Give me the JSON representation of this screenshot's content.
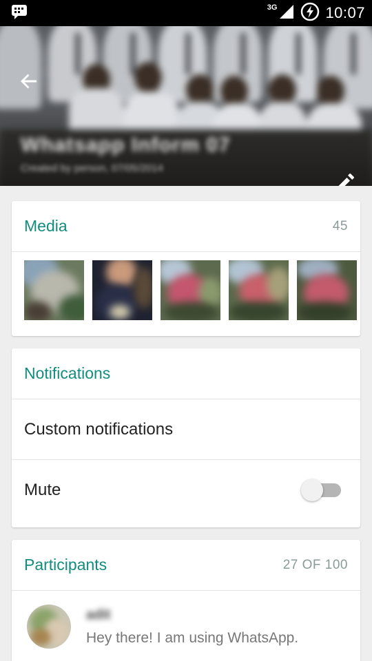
{
  "status_bar": {
    "network_type": "3G",
    "time": "10:07",
    "icons": [
      "bbm-chat-icon",
      "signal-icon",
      "battery-charging-icon"
    ]
  },
  "header": {
    "group_name": "Whatsapp Inform 07",
    "created_by": "Created by person, 07/05/2014",
    "back_icon": "arrow-back-icon",
    "edit_icon": "pencil-icon"
  },
  "media": {
    "title": "Media",
    "count": "45",
    "thumbnails": [
      "media-thumb-1",
      "media-thumb-2",
      "media-thumb-3",
      "media-thumb-4",
      "media-thumb-5"
    ]
  },
  "notifications": {
    "title": "Notifications",
    "custom_label": "Custom notifications",
    "mute_label": "Mute",
    "mute_on": false
  },
  "participants": {
    "title": "Participants",
    "count": "27 OF 100",
    "list": [
      {
        "name": "adit",
        "status": "Hey there! I am using WhatsApp."
      }
    ]
  },
  "colors": {
    "accent": "#128c7e",
    "background": "#eeeeee",
    "status_bar": "#000000"
  }
}
